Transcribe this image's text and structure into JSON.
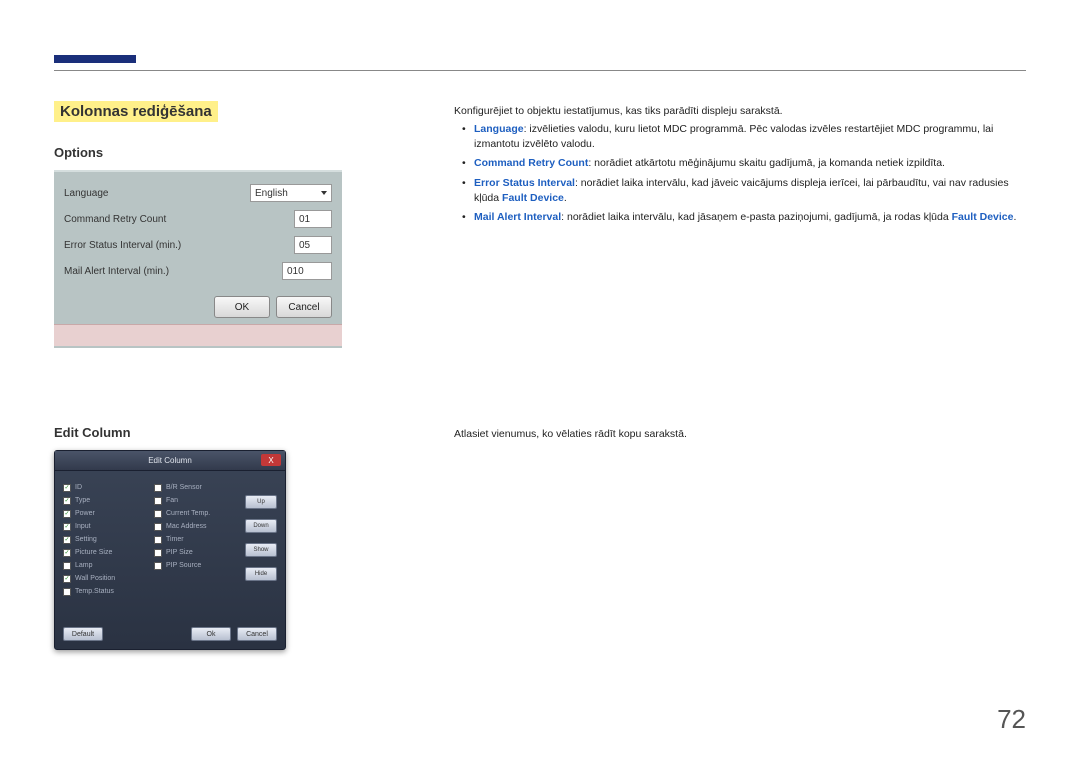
{
  "heading": "Kolonnas rediģēšana",
  "options_heading": "Options",
  "edit_heading": "Edit Column",
  "page_number": "72",
  "intro": "Konfigurējiet to objektu iestatījumus, kas tiks parādīti displeju sarakstā.",
  "bullets": {
    "b1_label": "Language",
    "b1_text": ": izvēlieties valodu, kuru lietot MDC programmā. Pēc valodas izvēles restartējiet MDC programmu, lai izmantotu izvēlēto valodu.",
    "b2_label": "Command Retry Count",
    "b2_text": ": norādiet atkārtotu mēģinājumu skaitu gadījumā, ja komanda netiek izpildīta.",
    "b3_label": "Error Status Interval",
    "b3_text": ": norādiet laika intervālu, kad jāveic vaicājums displeja ierīcei, lai pārbaudītu, vai nav radusies kļūda ",
    "b3_ref": "Fault Device",
    "b4_label": "Mail Alert Interval",
    "b4_text": ": norādiet laika intervālu, kad jāsaņem e-pasta paziņojumi, gadījumā, ja rodas kļūda ",
    "b4_ref": "Fault Device"
  },
  "edit_text": "Atlasiet vienumus, ko vēlaties rādīt kopu sarakstā.",
  "options_dialog": {
    "rows": {
      "language": "Language",
      "language_val": "English",
      "retry": "Command Retry Count",
      "retry_val": "01",
      "error": "Error Status Interval (min.)",
      "error_val": "05",
      "mail": "Mail Alert Interval (min.)",
      "mail_val": "010"
    },
    "ok": "OK",
    "cancel": "Cancel"
  },
  "edit_dialog": {
    "title": "Edit Column",
    "close": "X",
    "col1": {
      "i0": "ID",
      "i1": "Type",
      "i2": "Power",
      "i3": "Input",
      "i4": "Setting",
      "i5": "Picture Size",
      "i6": "Lamp",
      "i7": "Wall Position",
      "i8": "Temp.Status"
    },
    "col2": {
      "i0": "B/R Sensor",
      "i1": "Fan",
      "i2": "Current Temp.",
      "i3": "Mac Address",
      "i4": "Timer",
      "i5": "PIP Size",
      "i6": "PIP Source"
    },
    "btns": {
      "up": "Up",
      "down": "Down",
      "show": "Show",
      "hide": "Hide"
    },
    "footer": {
      "default": "Default",
      "ok": "Ok",
      "cancel": "Cancel"
    }
  }
}
